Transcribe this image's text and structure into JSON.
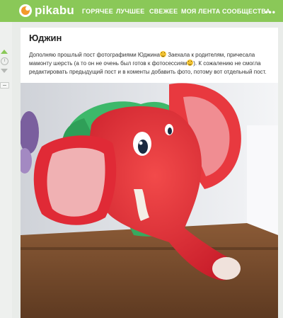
{
  "header": {
    "logo_text": "pikabu",
    "nav": [
      {
        "label": "ГОРЯЧЕЕ"
      },
      {
        "label": "ЛУЧШЕЕ"
      },
      {
        "label": "СВЕЖЕЕ"
      },
      {
        "label": "МОЯ ЛЕНТА"
      },
      {
        "label": "СООБЩЕСТВА"
      }
    ],
    "more_icon": "more-dots-icon",
    "colors": {
      "bar": "#8ac858",
      "accent": "#f39a2b"
    }
  },
  "sidebar": {
    "icons": [
      "upvote-arrow-icon",
      "clock-icon",
      "downvote-arrow-icon",
      "flag-icon"
    ]
  },
  "post": {
    "title": "Юджин",
    "text_part1": "Дополняю прошлый пост фотографиями Юджина",
    "text_part2": " Заехала к родителям, причесала мамонту шерсть (а то он не очень был готов к фотосессиям",
    "text_part3": "). К сожалению не смогла редактировать предыдущий пост и в коменты добавить фото, потому вот отдельный пост.",
    "emoji": "smile-emoji-icon"
  }
}
